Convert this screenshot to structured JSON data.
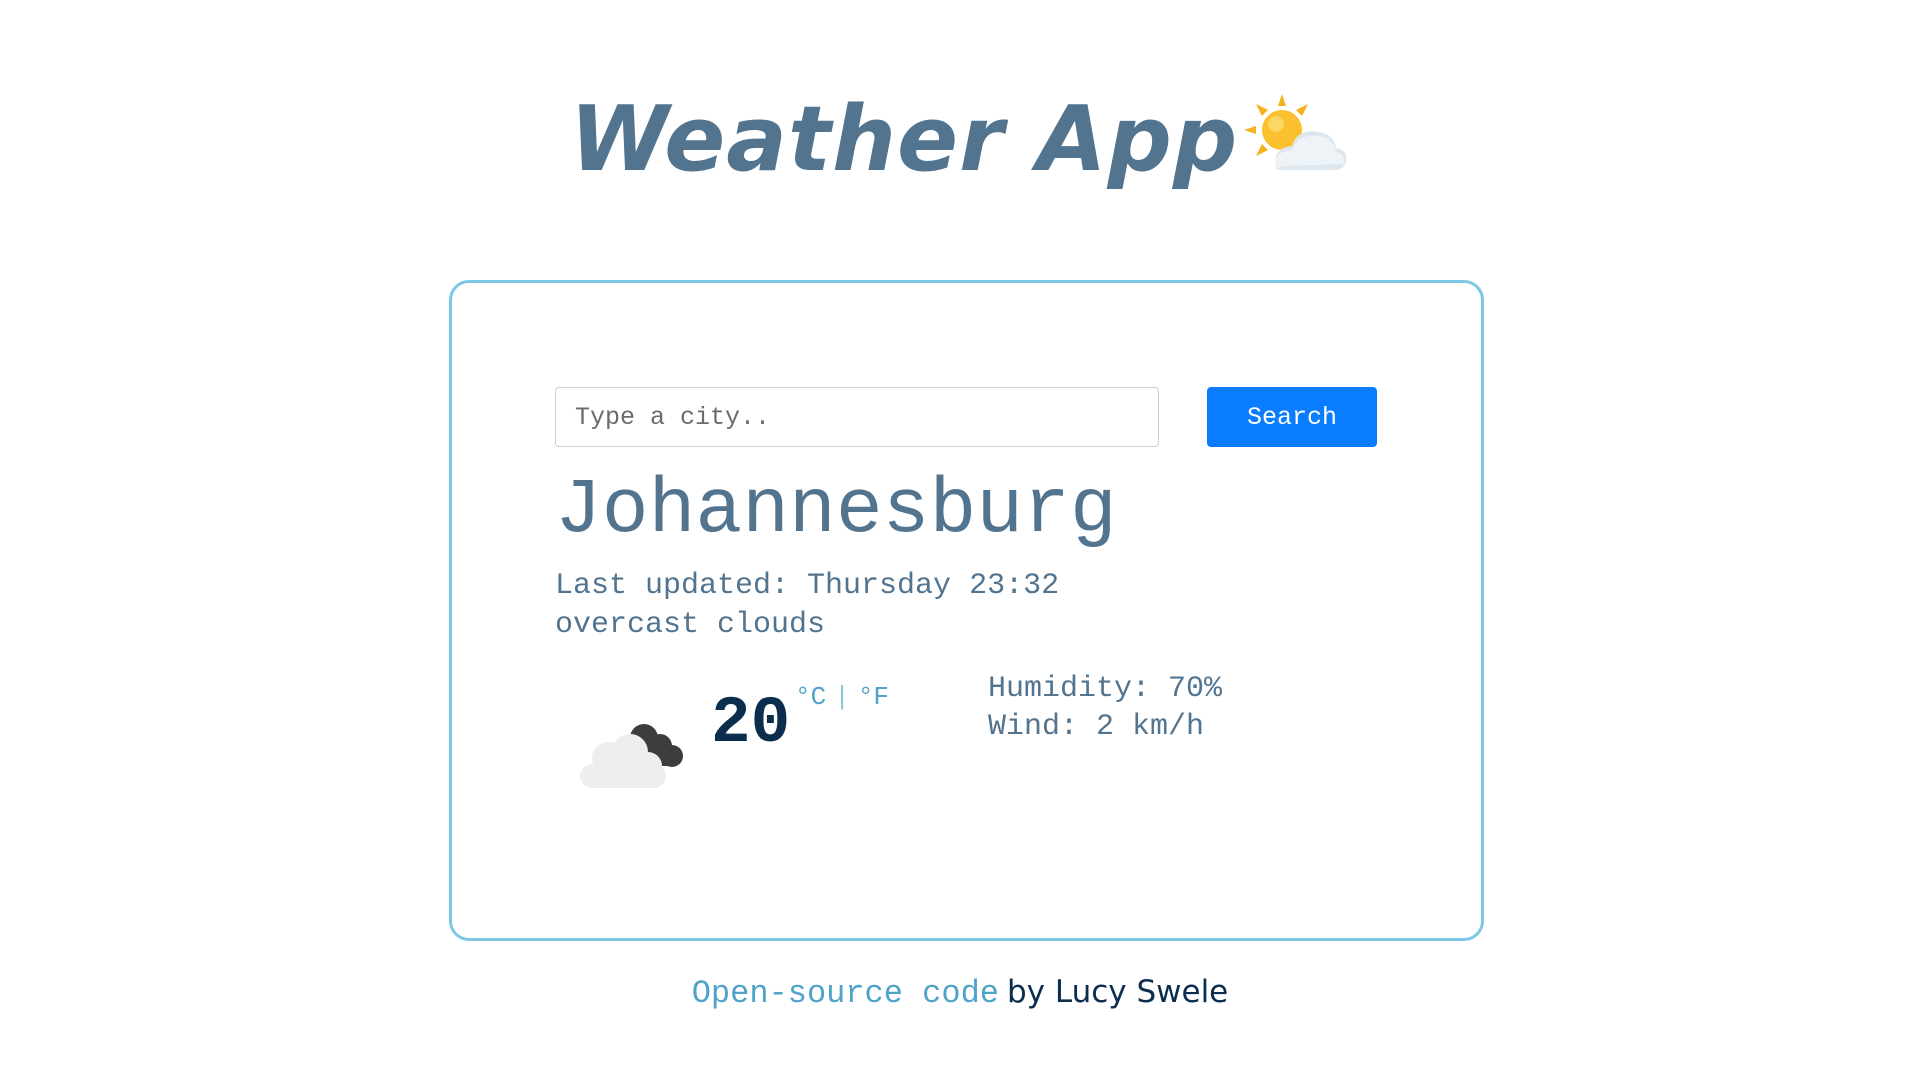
{
  "header": {
    "title": "Weather App",
    "title_icon": "sun-behind-cloud-icon"
  },
  "search": {
    "placeholder": "Type a city..",
    "value": "",
    "button_label": "Search"
  },
  "weather": {
    "city": "Johannesburg",
    "last_updated": "Last updated: Thursday 23:32",
    "description": "overcast clouds",
    "icon": "overcast-clouds-icon",
    "temperature": "20",
    "unit_celsius": "°C",
    "unit_separator": "|",
    "unit_fahrenheit": "°F",
    "humidity": "Humidity: 70%",
    "wind": "Wind: 2 km/h"
  },
  "footer": {
    "link_text": "Open-source code",
    "credit": "by Lucy Swele"
  },
  "colors": {
    "heading": "#52748f",
    "card_border": "#7cc8e6",
    "button": "#0a7cff",
    "temperature": "#0b2d4e",
    "link": "#4fa3c9"
  }
}
